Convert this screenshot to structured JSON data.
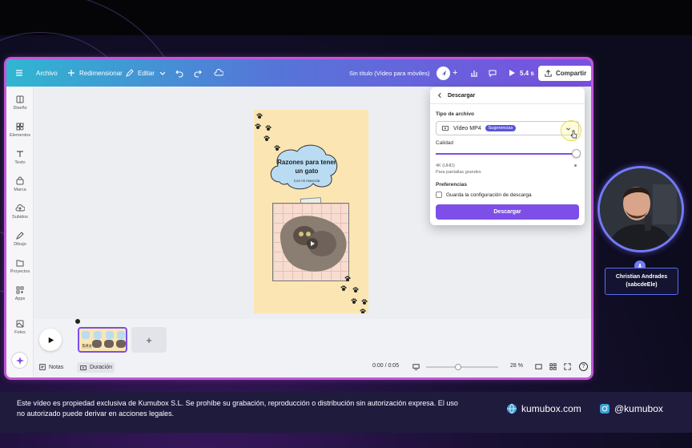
{
  "toolbar": {
    "file": "Archivo",
    "resize": "Redimensionar",
    "edit": "Editar",
    "doc_title": "Sin título (Vídeo para móviles)",
    "duration": "5.4 s",
    "share": "Compartir"
  },
  "sidebar": {
    "items": [
      {
        "label": "Diseño",
        "icon": "layout-icon"
      },
      {
        "label": "Elementos",
        "icon": "shapes-icon"
      },
      {
        "label": "Texto",
        "icon": "text-icon"
      },
      {
        "label": "Marca",
        "icon": "brand-icon"
      },
      {
        "label": "Subidos",
        "icon": "upload-icon"
      },
      {
        "label": "Dibujo",
        "icon": "pen-icon"
      },
      {
        "label": "Proyectos",
        "icon": "folder-icon"
      },
      {
        "label": "Apps",
        "icon": "apps-icon"
      },
      {
        "label": "Fotos",
        "icon": "photos-icon"
      }
    ]
  },
  "design": {
    "title": "Razones para tener un gato",
    "subtitle": "Con mi mascota"
  },
  "download_panel": {
    "title": "Descargar",
    "file_type_label": "Tipo de archivo",
    "file_type_value": "Vídeo MP4",
    "suggestion_badge": "Sugerencias",
    "quality_label": "Calidad",
    "quality_value": "4K (UHD)",
    "quality_hint": "Para pantallas grandes",
    "quality_level": 1.0,
    "preferences_label": "Preferencias",
    "save_settings_label": "Guarda la configuración de descarga",
    "save_settings_checked": false,
    "download_button": "Descargar"
  },
  "timeline": {
    "clip_duration": "5.4 s",
    "add_label": "+"
  },
  "bottombar": {
    "notes": "Notas",
    "duration": "Duración",
    "time": "0:00 / 0:05",
    "zoom": "28 %",
    "help": "?"
  },
  "presenter": {
    "name": "Christian Andrades",
    "handle": "(sabcdeEle)"
  },
  "footer": {
    "notice": "Este vídeo es propiedad exclusiva de Kumubox S.L. Se prohíbe su grabación, reproducción o distribución sin autorización expresa. El uso no autorizado puede derivar en acciones legales.",
    "website": "kumubox.com",
    "social": "@kumubox"
  },
  "colors": {
    "accent": "#7d4fe8",
    "toolbar_start": "#2fb6d1",
    "toolbar_end": "#7a4fe0",
    "design_bg": "#fbe6b3",
    "frame_glow": "#c257d8"
  }
}
